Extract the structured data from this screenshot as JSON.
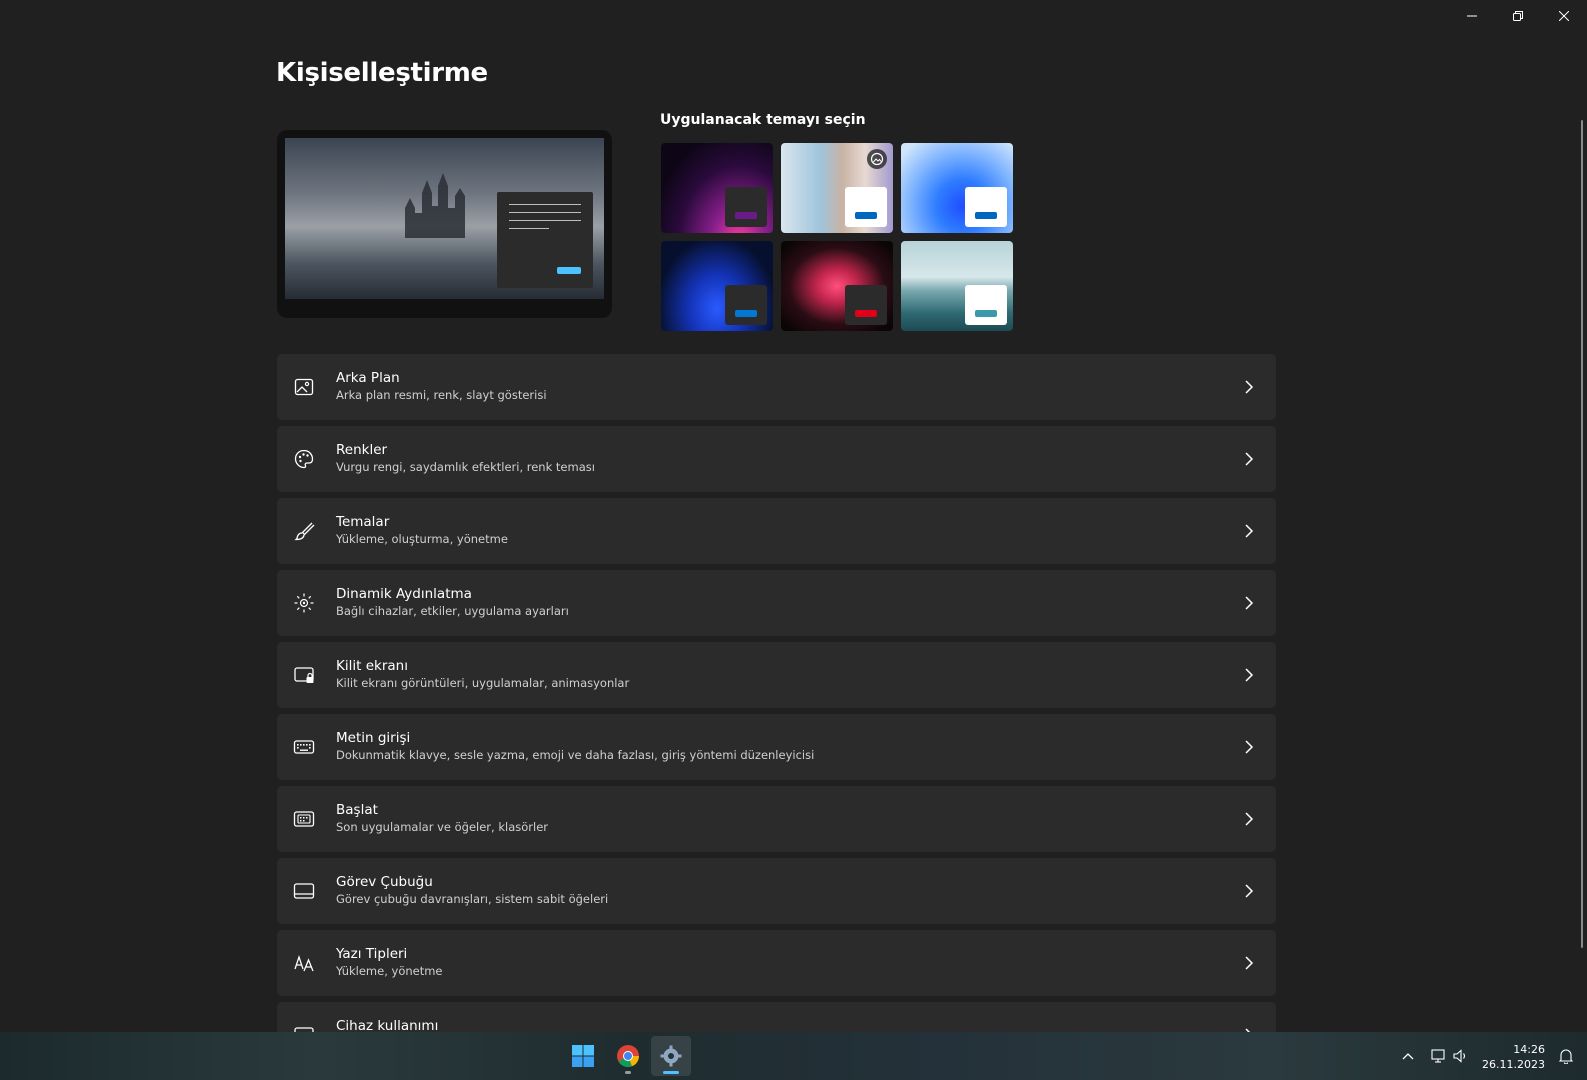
{
  "window": {
    "minimize_icon": "minimize-icon",
    "restore_icon": "restore-icon",
    "close_icon": "close-icon"
  },
  "page": {
    "title": "Kişiselleştirme"
  },
  "themes": {
    "label": "Uygulanacak temayı seçin",
    "items": [
      {
        "name": "theme-dark-glow",
        "accent": "#6b1a8a",
        "mini_bg": "#2b2b2b"
      },
      {
        "name": "theme-flowers",
        "accent": "#0067c0",
        "mini_bg": "#ffffff"
      },
      {
        "name": "theme-windows-light",
        "accent": "#0067c0",
        "mini_bg": "#ffffff"
      },
      {
        "name": "theme-windows-dark",
        "accent": "#0078d4",
        "mini_bg": "#2b2b2b"
      },
      {
        "name": "theme-captured-motion",
        "accent": "#e0001b",
        "mini_bg": "#2b2b2b"
      },
      {
        "name": "theme-sunrise-lake",
        "accent": "#3a9aa8",
        "mini_bg": "#ffffff"
      }
    ]
  },
  "settings": [
    {
      "title": "Arka Plan",
      "desc": "Arka plan resmi, renk, slayt gösterisi",
      "icon": "image-icon"
    },
    {
      "title": "Renkler",
      "desc": "Vurgu rengi, saydamlık efektleri, renk teması",
      "icon": "palette-icon"
    },
    {
      "title": "Temalar",
      "desc": "Yükleme, oluşturma, yönetme",
      "icon": "brush-icon"
    },
    {
      "title": "Dinamik Aydınlatma",
      "desc": "Bağlı cihazlar, etkiler, uygulama ayarları",
      "icon": "lighting-icon"
    },
    {
      "title": "Kilit ekranı",
      "desc": "Kilit ekranı görüntüleri, uygulamalar, animasyonlar",
      "icon": "lock-screen-icon"
    },
    {
      "title": "Metin girişi",
      "desc": "Dokunmatik klavye, sesle yazma, emoji ve daha fazlası, giriş yöntemi düzenleyicisi",
      "icon": "keyboard-icon"
    },
    {
      "title": "Başlat",
      "desc": "Son uygulamalar ve öğeler, klasörler",
      "icon": "start-icon"
    },
    {
      "title": "Görev Çubuğu",
      "desc": "Görev çubuğu davranışları, sistem sabit öğeleri",
      "icon": "taskbar-icon"
    },
    {
      "title": "Yazı Tipleri",
      "desc": "Yükleme, yönetme",
      "icon": "fonts-icon"
    },
    {
      "title": "Cihaz kullanımı",
      "desc": "",
      "icon": "device-usage-icon"
    }
  ],
  "taskbar": {
    "apps": [
      "windows-start-icon",
      "chrome-icon",
      "settings-gear-icon"
    ],
    "time": "14:26",
    "date": "26.11.2023"
  }
}
